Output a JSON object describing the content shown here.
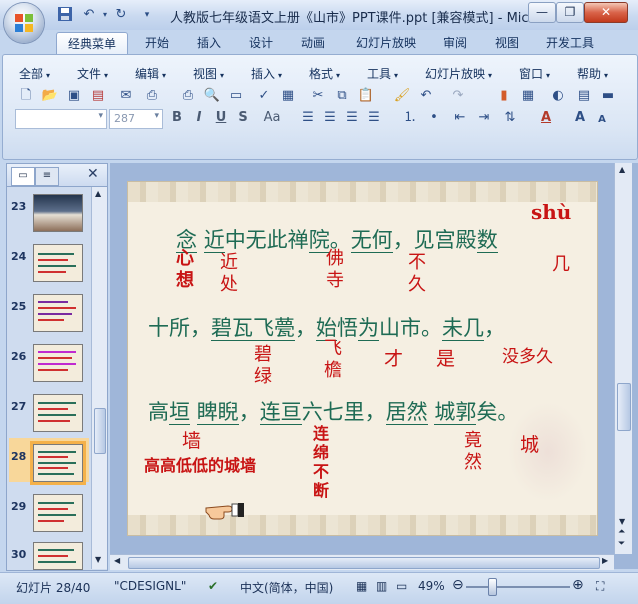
{
  "window": {
    "title": "人教版七年级语文上册《山市》PPT课件.ppt [兼容模式] - Mic...",
    "minimize_icon": "minimize-icon",
    "maximize_icon": "restore-icon",
    "close_icon": "close-icon"
  },
  "quick_access": {
    "save": "save-icon",
    "undo": "undo-icon",
    "redo": "redo-icon",
    "customize": "dropdown-icon"
  },
  "tabs": [
    "经典菜单",
    "开始",
    "插入",
    "设计",
    "动画",
    "幻灯片放映",
    "审阅",
    "视图",
    "开发工具"
  ],
  "active_tab": "经典菜单",
  "menus": [
    "全部",
    "文件",
    "编辑",
    "视图",
    "插入",
    "格式",
    "工具",
    "幻灯片放映",
    "窗口",
    "帮助"
  ],
  "font_size_value": "287",
  "format_buttons": {
    "bold": "B",
    "italic": "I",
    "underline": "U",
    "strike": "S",
    "case": "Aa"
  },
  "pane": {
    "close": "✕",
    "slides": [
      "23",
      "24",
      "25",
      "26",
      "27",
      "28",
      "29",
      "30"
    ],
    "selected": "28"
  },
  "slide": {
    "pinyin": "shù",
    "line1": {
      "p1": "念",
      "p2": "近",
      "p3": "中无此禅",
      "p4": "院",
      "p5": "。",
      "p6": "无何",
      "p7": "，见宫殿",
      "p8": "数"
    },
    "note1": {
      "xin": "心\n想",
      "jin": "近\n处",
      "fo": "佛\n寺",
      "bu": "不\n久",
      "ji": "几"
    },
    "line2": {
      "p1": "十所，",
      "p2": "碧瓦飞甍",
      "p3": "，",
      "p4": "始",
      "p5": "悟",
      "p6": "为",
      "p7": "山市",
      "p8": "。",
      "p9": "未几",
      "p10": "，"
    },
    "note2": {
      "bi": "碧\n绿",
      "fei": "飞\n檐",
      "cai": "才",
      "shi": "是",
      "mei": "没多久"
    },
    "line3": {
      "p1": "高",
      "p2": "垣",
      "p3": " ",
      "p4": "睥睨",
      "p5": "，",
      "p6": "连亘",
      "p7": "六七里，",
      "p8": "居然",
      "p9": " ",
      "p10": "城郭",
      "p11": "矣。"
    },
    "note3": {
      "qiang": "墙",
      "lian": "连\n绵\n不\n断",
      "jing": "竟\n然",
      "cheng": "城",
      "gaodi": "高高低低的城墙"
    },
    "pointer_icon": "pointing-hand-icon"
  },
  "status": {
    "slide_count": "幻灯片 28/40",
    "theme": "\"CDESIGNL\"",
    "language": "中文(简体，中国)",
    "zoom": "49%",
    "zoom_fraction": 0.25
  }
}
